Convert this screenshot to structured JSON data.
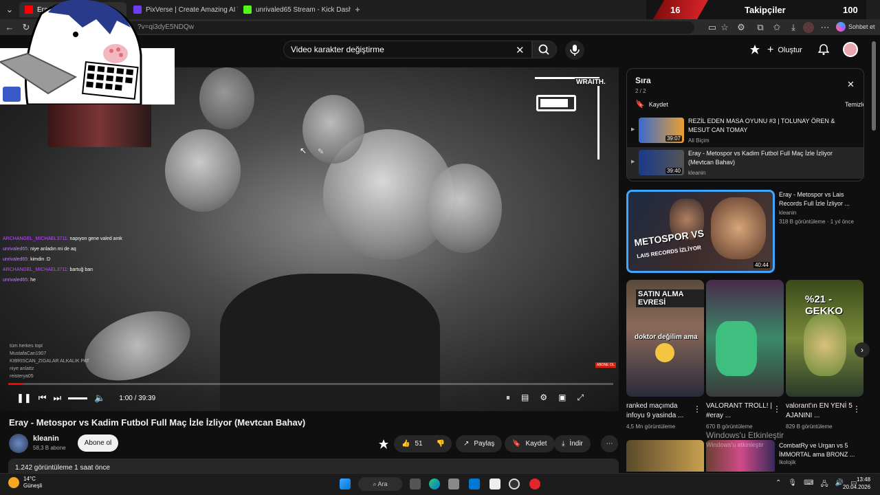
{
  "browser": {
    "tabs": [
      {
        "label": "Eray - Met",
        "color": "#ff0000"
      },
      {
        "label": "PixVerse | Create Amazing AI Vide",
        "color": "#6b3ef5"
      },
      {
        "label": "unrivaled65 Stream - Kick Dashboa",
        "color": "#53fc18"
      }
    ],
    "url": "?v=qi3dyE5NDQw",
    "copilot_label": "Sohbet et"
  },
  "stream_overlay": {
    "follower_count": "16",
    "follower_label": "Takipçiler",
    "follower_goal": "100",
    "hud_label": "WRAITH."
  },
  "header": {
    "search_value": "Video karakter değiştirme",
    "create_label": "Oluştur"
  },
  "chat": [
    {
      "user": "ARCHANGEL_MICHAEL3711:",
      "msg": "napıyon gene valed amk",
      "user_color": "#b84dff"
    },
    {
      "user": "unrivaled65:",
      "msg": "niye anladın mi de aq",
      "user_color": "#c47dff"
    },
    {
      "user": "unrivaled65:",
      "msg": "kimdin :D",
      "user_color": "#c47dff"
    },
    {
      "user": "ARCHANGEL_MICHAEL3711:",
      "msg": "bartuğ ban",
      "user_color": "#b84dff"
    },
    {
      "user": "unrivaled65:",
      "msg": "he",
      "user_color": "#c47dff"
    }
  ],
  "chat_lower": [
    "tüm herkes topl",
    "MustafaCan1907",
    "KIBRISCAN_ZIGALAR ALKALIK PAT",
    "niye anlattz",
    "reisterya05"
  ],
  "player": {
    "time": "1:00 / 39:39",
    "progress": 0.025,
    "abone_badge": "ABONE OL"
  },
  "video": {
    "title": "Eray - Metospor vs Kadim Futbol Full Maç İzle İzliyor (Mevtcan Bahav)",
    "channel": "kleanin",
    "subscribers": "58,3 B abone",
    "subscribe_label": "Abone ol",
    "likes": "51",
    "share_label": "Paylaş",
    "save_label": "Kaydet",
    "download_label": "İndir",
    "stats": "1.242 görüntüleme  1 saat önce"
  },
  "queue": {
    "title": "Sıra",
    "position": "2 / 2",
    "save_label": "Kaydet",
    "clear_label": "Temizle",
    "items": [
      {
        "title": "REZİL EDEN MASA OYUNU #3 | TOLUNAY ÖREN & MESUT CAN TOMAY",
        "channel": "Ali Biçim",
        "duration": "39:07"
      },
      {
        "title": "Eray - Metospor vs Kadim Futbol Full Maç İzle İzliyor (Mevtcan Bahav)",
        "channel": "kleanin",
        "duration": "39:40"
      }
    ]
  },
  "featured": {
    "title": "Eray - Metospor vs Lais Records Full İzle İzliyor ...",
    "channel": "kleanin",
    "meta": "318 B görüntüleme · 1 yıl önce",
    "thumb_text1": "METOSPOR VS",
    "thumb_text2": "LAIS RECORDS İZLİYOR",
    "duration": "40:44"
  },
  "shorts": [
    {
      "caption": "SATIN ALMA EVRESİ",
      "caption2": "doktor değilim ama",
      "title": "ranked maçımda infoyu 9 yasinda ...",
      "views": "4,5 Mn görüntüleme"
    },
    {
      "caption": "",
      "caption2": "",
      "title": "VALORANT TROLL! | #eray ...",
      "views": "670 B görüntüleme"
    },
    {
      "caption": "%21 - GEKKO",
      "caption2": "",
      "title": "valorant'ın EN YENİ 5 AJANINI ...",
      "views": "829 B görüntüleme"
    }
  ],
  "recommendation": {
    "title": "CombatRy ve Urgan vs 5 İMMORTAL ama BRONZ ...",
    "channel": "Ikolojik"
  },
  "watermark": {
    "line1": "Windows'u Etkinleştir",
    "line2": "Windows'u etkinleştir"
  },
  "taskbar": {
    "temp": "14°C",
    "weather": "Güneşli",
    "search_label": "Ara",
    "time": "13:48",
    "date": "20.04.2026"
  }
}
